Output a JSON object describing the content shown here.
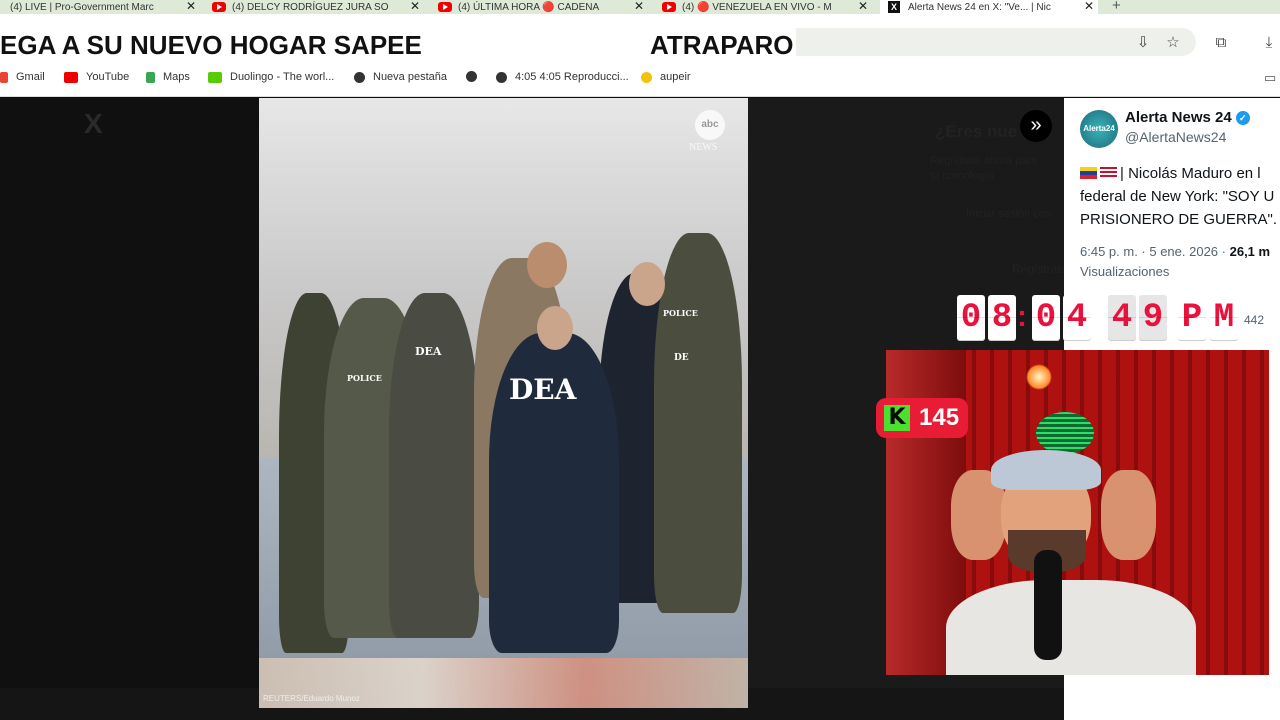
{
  "browser": {
    "tabs": [
      {
        "label": "(4) LIVE | Pro-Government Marc",
        "icon": "youtube-icon"
      },
      {
        "label": "(4) DELCY RODRÍGUEZ JURA SO",
        "icon": "youtube-icon"
      },
      {
        "label": "(4) ÚLTIMA HORA 🔴 CADENA",
        "icon": "youtube-icon"
      },
      {
        "label": "(4) 🔴 VENEZUELA EN VIVO - M",
        "icon": "youtube-icon"
      },
      {
        "label": "Alerta News 24 en X: \"Ve... | Nic",
        "icon": "x-icon"
      }
    ],
    "new_tab": "+",
    "bookmarks": [
      "Gmail",
      "YouTube",
      "Maps",
      "Duolingo - The worl...",
      "Nueva pestaña",
      "",
      "4:05 4:05 Reproducci...",
      "aupeir"
    ]
  },
  "stream_overlay": {
    "headline_left": "EGA A SU NUEVO HOGAR SAPEE",
    "headline_right": "ATRAPARO",
    "clock_digits": [
      "0",
      "8",
      "0",
      "4",
      "4",
      "9",
      "P",
      "M"
    ],
    "k_badge_letter": "K",
    "k_badge_count": "145"
  },
  "media_viewer": {
    "close_symbol": "X",
    "next_symbol": "»",
    "photo_watermark": "abc",
    "photo_watermark_sub": "NEWS",
    "photo_credit": "REUTERS/Eduardo Munoz",
    "vest_labels": [
      "DEA",
      "DEA",
      "POLICE",
      "POLICE",
      "DE"
    ],
    "dim_side_text": [
      "¿Eres nue",
      "Regístrate ahora para",
      "tu cronología",
      "Iniciar sesión con",
      "Regístrate"
    ]
  },
  "tweet": {
    "author_name": "Alerta News 24",
    "author_handle": "@AlertaNews24",
    "avatar_text": "Alerta24",
    "verified_symbol": "✓",
    "body_line1": "| Nicolás Maduro en l",
    "body_line2": "federal de New York: \"SOY U",
    "body_line3": "PRISIONERO DE GUERRA\".",
    "timestamp": "6:45 p. m. · 5 ene. 2026 ·",
    "views_count": "26,1 m",
    "views_label": "Visualizaciones",
    "reply_count": "442"
  }
}
